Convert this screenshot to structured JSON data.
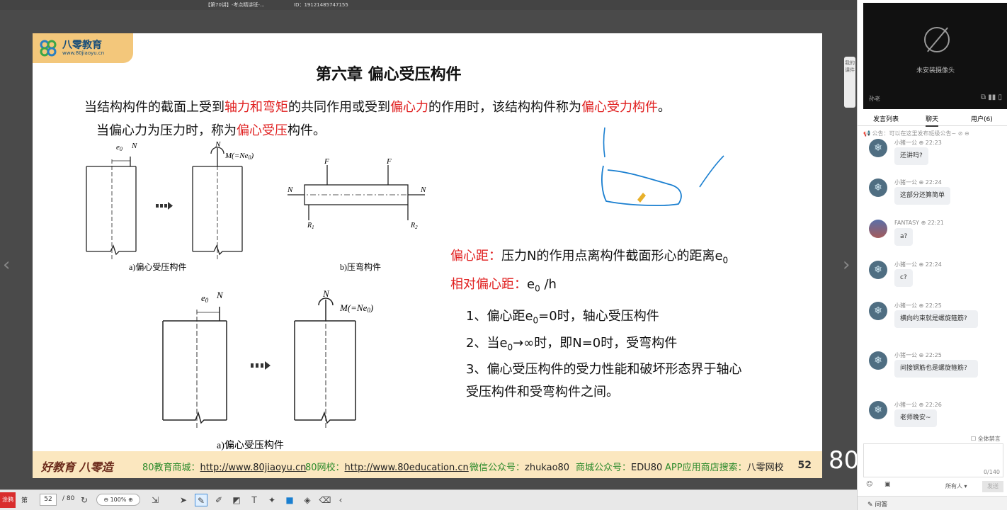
{
  "window": {
    "title": "【第70讲】-考点精讲班-...",
    "user_id": "ID：19121485747155"
  },
  "slide": {
    "logo_name": "八零教育",
    "logo_url": "www.80jiaoyu.cn",
    "title": "第六章  偏心受压构件",
    "intro": {
      "s1": "当结构构件的截面上受到",
      "r1": "轴力和弯矩",
      "s2": "的共同作用或受到",
      "r2": "偏心力",
      "s3": "的作用时，该结构构件称为",
      "r3": "偏心受力构件",
      "s4": "。"
    },
    "intro2": {
      "s1": "当偏心力为压力时，称为",
      "r1": "偏心受压",
      "s2": "构件。"
    },
    "figures": {
      "label_e0": "e",
      "label_e0_sub": "0",
      "label_N": "N",
      "label_M": "M(=Ne",
      "label_M_sub": "0",
      "label_M_end": ")",
      "label_F": "F",
      "label_R1": "R",
      "label_R1_sub": "1",
      "label_R2": "R",
      "label_R2_sub": "2",
      "caption_a": "a)偏心受压构件",
      "caption_b": "b)压弯构件",
      "caption_a2": "a)偏心受压构件"
    },
    "def1_label": "偏心距：",
    "def1_text": "压力N的作用点离构件截面形心的距离e",
    "def1_sub": "0",
    "def2_label": "相对偏心距：",
    "def2_text": "e",
    "def2_sub": "0",
    "def2_end": " /h",
    "list": {
      "i1a": "1、偏心距e",
      "i1sub": "0",
      "i1b": "=0时，轴心受压构件",
      "i2a": "2、当e",
      "i2sub": "0",
      "i2b": "→∞时，即N=0时，受弯构件",
      "i3a": "3、偏心受压构件的受力性能和破坏形态界于轴心",
      "i3b": "受压构件和受弯构件之间。"
    },
    "footer": {
      "slogan": "好教育 八零造",
      "shop_label": "80教育商城：",
      "shop_url": "http://www.80jiaoyu.cn",
      "school_label": "80网校：",
      "school_url": "http://www.80education.cn",
      "wechat_label": "微信公众号：",
      "wechat": "zhukao80",
      "mall_label": "商城公众号：",
      "mall": "EDU80",
      "app_label": "APP应用商店搜索：",
      "app": "八零网校",
      "page": "52"
    }
  },
  "toolbar": {
    "tag": "涂鸦",
    "sync_label": "第",
    "page_current": "52",
    "page_total": "/ 80",
    "zoom": "100%"
  },
  "side_tab": "我的课件",
  "overlay_number": "80",
  "sidebar": {
    "camera_msg": "未安装摄像头",
    "camera_name": "孙老",
    "tabs": [
      "发言列表",
      "聊天",
      "用户(6)"
    ],
    "active_tab": 1,
    "notice": "公告：可以在这里发布班级公告~",
    "messages": [
      {
        "name": "小猪一公",
        "time": "22:23",
        "text": "还讲吗?",
        "avatar": "snow"
      },
      {
        "name": "小猪一公",
        "time": "22:24",
        "text": "这部分还算简单",
        "avatar": "snow"
      },
      {
        "name": "FANTASY",
        "time": "22:21",
        "text": "a?",
        "avatar": "photo"
      },
      {
        "name": "小猪一公",
        "time": "22:24",
        "text": "c?",
        "avatar": "snow"
      },
      {
        "name": "小猪一公",
        "time": "22:25",
        "text": "横向约束就是螺旋箍筋?",
        "avatar": "snow"
      },
      {
        "name": "小猪一公",
        "time": "22:25",
        "text": "间接钢筋也是螺旋箍筋?",
        "avatar": "snow"
      },
      {
        "name": "小猪一公",
        "time": "22:26",
        "text": "老师晚安~",
        "avatar": "snow"
      }
    ],
    "all_mute": "全体禁言",
    "counter": "0/140",
    "recipient": "所有人",
    "send": "发送",
    "qa": "问答"
  }
}
